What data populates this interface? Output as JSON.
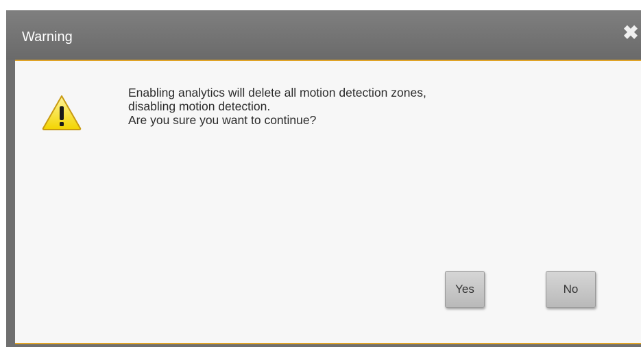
{
  "dialog": {
    "title": "Warning",
    "close_icon": "close-icon",
    "warning_icon": "warning-triangle-icon",
    "message_lines": [
      "Enabling analytics will delete all motion detection zones,",
      "disabling motion detection.",
      "Are you sure you want to continue?"
    ],
    "yes_label": "Yes",
    "no_label": "No",
    "accent_color": "#e0a326",
    "titlebar_color": "#6f6f6f"
  }
}
